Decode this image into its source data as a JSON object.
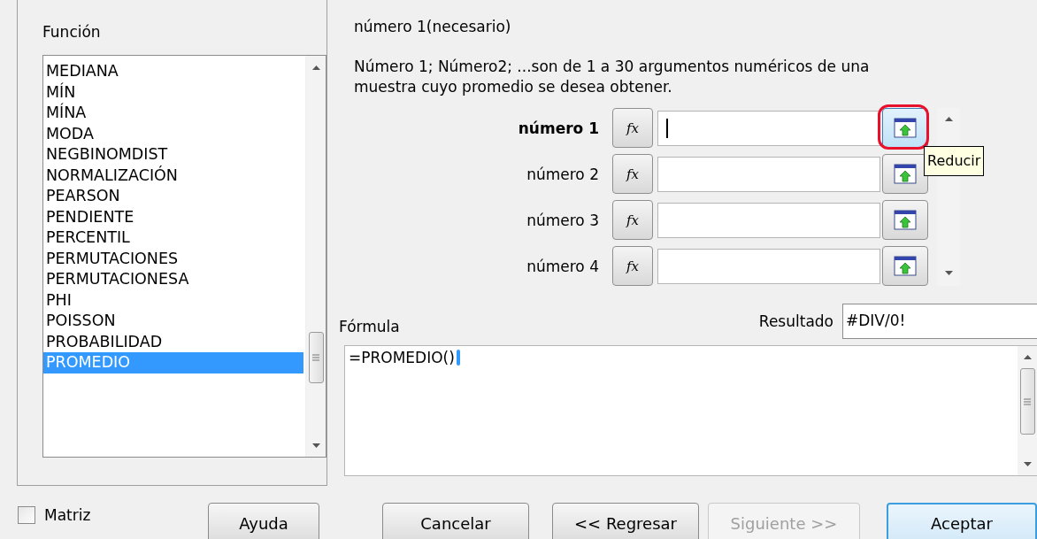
{
  "function_panel": {
    "label": "Función",
    "items": [
      {
        "label": "MEDIANA",
        "selected": false
      },
      {
        "label": "MÍN",
        "selected": false
      },
      {
        "label": "MÍNA",
        "selected": false
      },
      {
        "label": "MODA",
        "selected": false
      },
      {
        "label": "NEGBINOMDIST",
        "selected": false
      },
      {
        "label": "NORMALIZACIÓN",
        "selected": false
      },
      {
        "label": "PEARSON",
        "selected": false
      },
      {
        "label": "PENDIENTE",
        "selected": false
      },
      {
        "label": "PERCENTIL",
        "selected": false
      },
      {
        "label": "PERMUTACIONES",
        "selected": false
      },
      {
        "label": "PERMUTACIONESA",
        "selected": false
      },
      {
        "label": "PHI",
        "selected": false
      },
      {
        "label": "POISSON",
        "selected": false
      },
      {
        "label": "PROBABILIDAD",
        "selected": false
      },
      {
        "label": "PROMEDIO",
        "selected": true
      }
    ]
  },
  "argument_title": "número 1(necesario)",
  "argument_description": "Número 1; Número2; ...son de 1 a 30 argumentos numéricos de una muestra cuyo promedio se desea obtener.",
  "arguments": [
    {
      "label": "número 1",
      "button": "fx",
      "active": true
    },
    {
      "label": "número 2",
      "button": "fx",
      "active": false
    },
    {
      "label": "número 3",
      "button": "fx",
      "active": false
    },
    {
      "label": "número 4",
      "button": "fx",
      "active": false
    }
  ],
  "tooltip": "Reducir",
  "formula": {
    "label": "Fórmula",
    "value": "=PROMEDIO()"
  },
  "result": {
    "label": "Resultado",
    "value": "#DIV/0!"
  },
  "matrix": {
    "label": "Matriz",
    "checked": false
  },
  "buttons": [
    {
      "label": "Ayuda",
      "disabled": false,
      "default": false
    },
    {
      "label": "Cancelar",
      "disabled": false,
      "default": false
    },
    {
      "label": "<< Regresar",
      "disabled": false,
      "default": false
    },
    {
      "label": "Siguiente >>",
      "disabled": true,
      "default": false
    },
    {
      "label": "Aceptar",
      "disabled": false,
      "default": true
    }
  ]
}
